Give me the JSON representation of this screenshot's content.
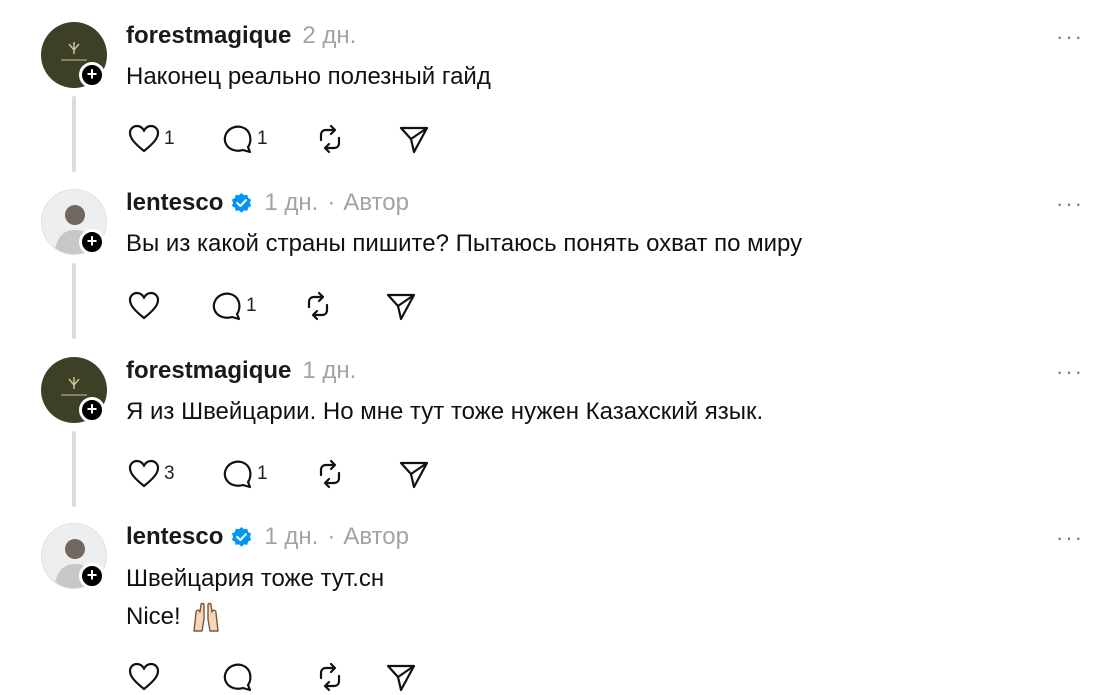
{
  "comments": [
    {
      "username": "forestmagique",
      "time": "2 дн.",
      "text": "Наконец реально полезный гайд",
      "likes": "1",
      "replies": "1"
    },
    {
      "username": "lentesco",
      "time": "1 дн.",
      "separator": "·",
      "role": "Автор",
      "text": "Вы из какой страны пишите? Пытаюсь понять охват по миру",
      "likes": "",
      "replies": "1"
    },
    {
      "username": "forestmagique",
      "time": "1 дн.",
      "text": "Я из Швейцарии. Но мне тут тоже нужен Казахский язык.",
      "likes": "3",
      "replies": "1"
    },
    {
      "username": "lentesco",
      "time": "1 дн.",
      "separator": "·",
      "role": "Автор",
      "text_line1": "Швейцария тоже тут.сн",
      "text_line2": "Nice!",
      "likes": "",
      "replies": ""
    }
  ],
  "more_label": "···",
  "colors": {
    "verified": "#0095f6",
    "muted": "#a3a3a3",
    "thread_line": "#dcdcdc"
  }
}
